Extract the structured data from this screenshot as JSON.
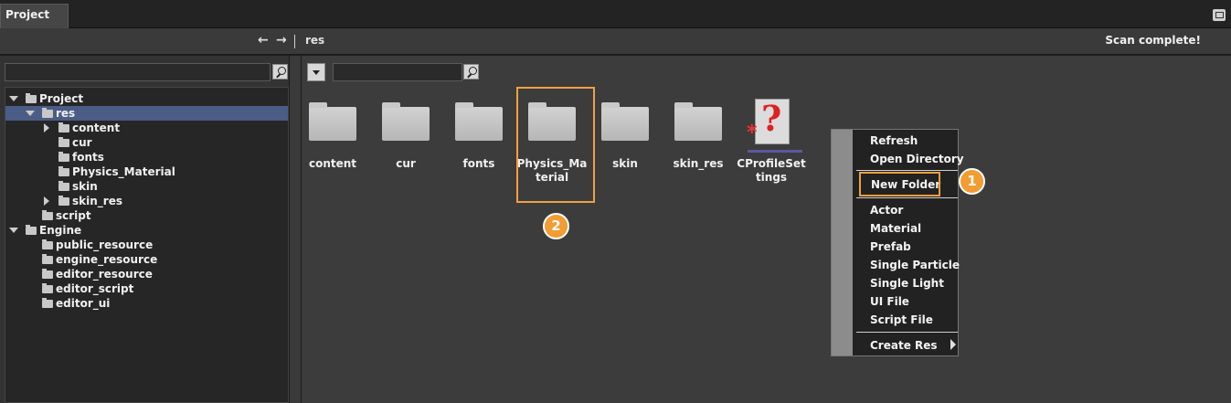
{
  "titlebar": {
    "tab_label": "Project"
  },
  "addressbar": {
    "back": "←",
    "forward": "→",
    "breadcrumb": "res",
    "status": "Scan complete!"
  },
  "tree": [
    {
      "label": "Project",
      "level": 0,
      "expander": "down"
    },
    {
      "label": "res",
      "level": 1,
      "expander": "down",
      "selected": true
    },
    {
      "label": "content",
      "level": 2,
      "expander": "right"
    },
    {
      "label": "cur",
      "level": 2,
      "expander": ""
    },
    {
      "label": "fonts",
      "level": 2,
      "expander": ""
    },
    {
      "label": "Physics_Material",
      "level": 2,
      "expander": ""
    },
    {
      "label": "skin",
      "level": 2,
      "expander": ""
    },
    {
      "label": "skin_res",
      "level": 2,
      "expander": "right"
    },
    {
      "label": "script",
      "level": 1,
      "expander": ""
    },
    {
      "label": "Engine",
      "level": 0,
      "expander": "down"
    },
    {
      "label": "public_resource",
      "level": 1,
      "expander": ""
    },
    {
      "label": "engine_resource",
      "level": 1,
      "expander": ""
    },
    {
      "label": "editor_resource",
      "level": 1,
      "expander": ""
    },
    {
      "label": "editor_script",
      "level": 1,
      "expander": ""
    },
    {
      "label": "editor_ui",
      "level": 1,
      "expander": ""
    }
  ],
  "files": [
    {
      "label": "content",
      "icon": "folder-icon"
    },
    {
      "label": "cur",
      "icon": "folder-icon"
    },
    {
      "label": "fonts",
      "icon": "folder-icon"
    },
    {
      "label": "Physics_Material",
      "icon": "folder-icon"
    },
    {
      "label": "skin",
      "icon": "folder-icon"
    },
    {
      "label": "skin_res",
      "icon": "folder-icon"
    },
    {
      "label": "CProfileSettings",
      "icon": "unknown-file-icon"
    }
  ],
  "context_menu": {
    "refresh": "Refresh",
    "open_directory": "Open Directory",
    "new_folder": "New Folder",
    "actor": "Actor",
    "material": "Material",
    "prefab": "Prefab",
    "single_particle": "Single Particle",
    "single_light": "Single Light",
    "ui_file": "UI File",
    "script_file": "Script File",
    "create_res": "Create Res"
  },
  "annotations": {
    "step1": "1",
    "step2": "2",
    "accent": "#f39c32"
  }
}
